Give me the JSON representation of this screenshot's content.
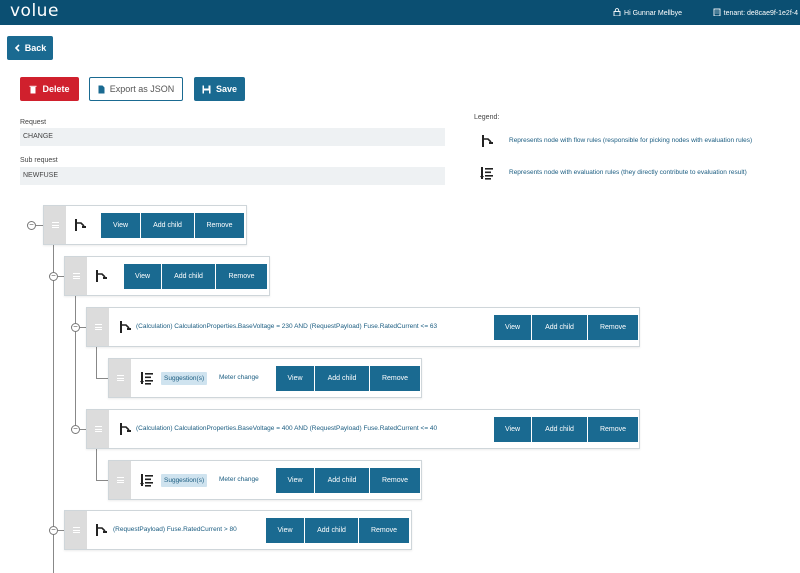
{
  "app": {
    "logo": "volue"
  },
  "header": {
    "user": "Hi Gunnar Mellbye",
    "tenant": "tenant: de8cae9f-1e2f-4"
  },
  "actions": {
    "back": "Back",
    "delete": "Delete",
    "export": "Export as JSON",
    "save": "Save"
  },
  "form": {
    "request_label": "Request",
    "request_value": "CHANGE",
    "subrequest_label": "Sub request",
    "subrequest_value": "NEWFUSE"
  },
  "legend": {
    "title": "Legend:",
    "flow_text": "Represents node with flow rules (responsible for picking nodes with evaluation rules)",
    "eval_text": "Represents node with evaluation rules (they directly contribute to evaluation result)"
  },
  "node_buttons": {
    "view": "View",
    "add_child": "Add child",
    "remove": "Remove"
  },
  "tree": {
    "n3": {
      "text": "(Calculation) CalculationProperties.BaseVoltage = 230 AND (RequestPayload) Fuse.RatedCurrent <= 63"
    },
    "n4": {
      "tag": "Suggestion(s)",
      "text": "Meter change"
    },
    "n5": {
      "text": "(Calculation) CalculationProperties.BaseVoltage = 400 AND (RequestPayload) Fuse.RatedCurrent <= 40"
    },
    "n6": {
      "tag": "Suggestion(s)",
      "text": "Meter change"
    },
    "n7": {
      "text": "(RequestPayload) Fuse.RatedCurrent > 80"
    }
  },
  "colors": {
    "header": "#0b4f72",
    "primary": "#1a6a91",
    "danger": "#d0202d",
    "field_bg": "#eef1f3"
  },
  "icons": {
    "flow": "flow-rule-icon",
    "eval": "evaluation-rule-icon"
  }
}
